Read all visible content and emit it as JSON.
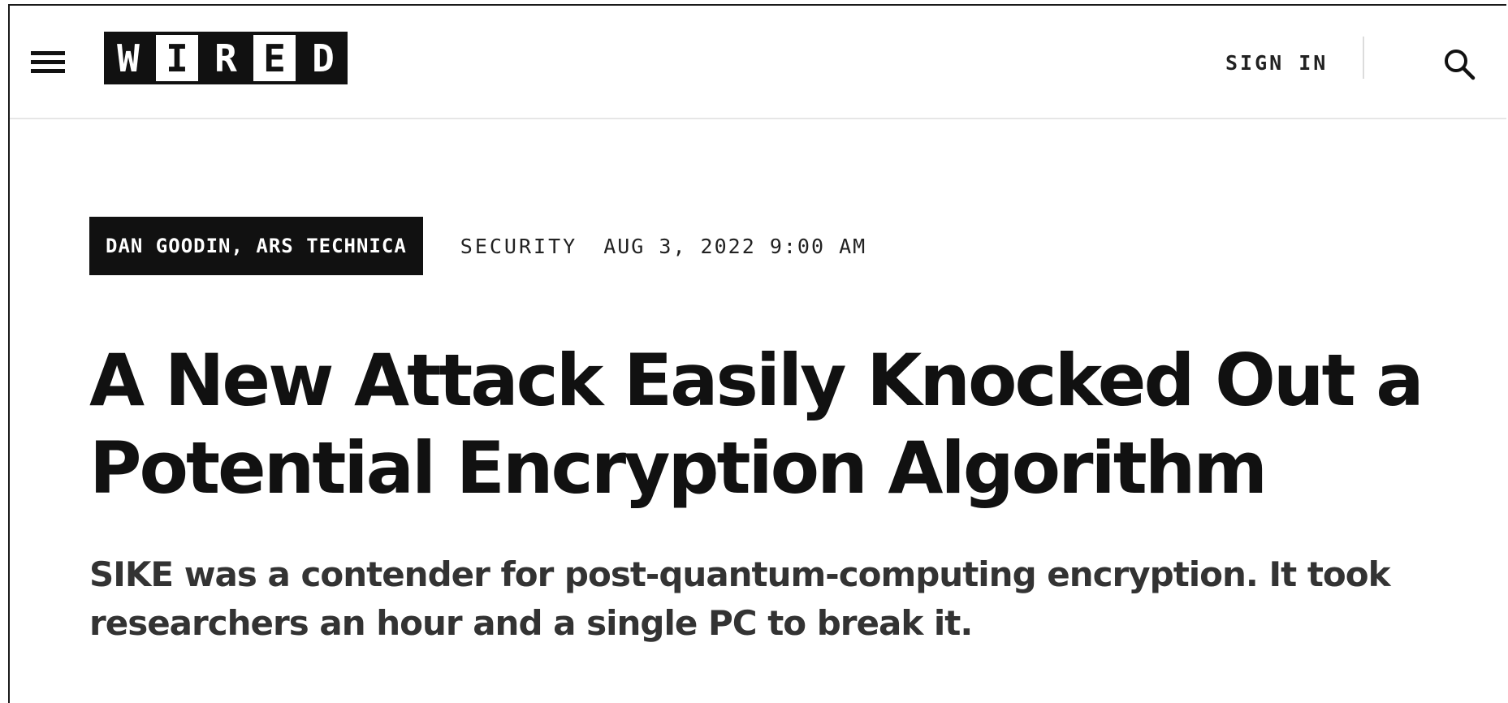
{
  "header": {
    "menu_icon": "hamburger-menu-icon",
    "logo_letters": [
      "W",
      "I",
      "R",
      "E",
      "D"
    ],
    "sign_in": "SIGN IN",
    "search_icon": "search-icon"
  },
  "article": {
    "byline": "DAN GOODIN, ARS TECHNICA",
    "category": "SECURITY",
    "date": "AUG 3, 2022 9:00 AM",
    "headline": "A New Attack Easily Knocked Out a Potential Encryption Algorithm",
    "dek": "SIKE was a contender for post-quantum-computing encryption. It took researchers an hour and a single PC to break it."
  },
  "colors": {
    "text": "#111111",
    "dek_text": "#333333",
    "header_rule": "#e6e6e6"
  }
}
